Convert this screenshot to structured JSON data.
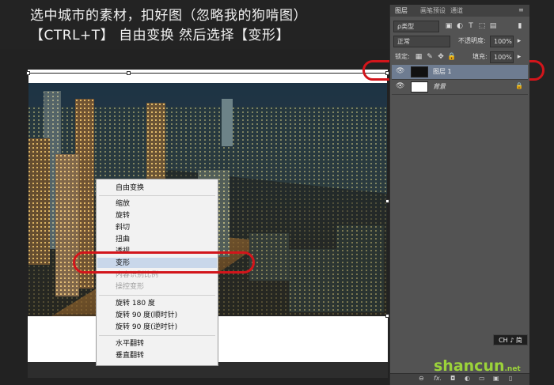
{
  "caption": {
    "line1": "选中城市的素材，扣好图（忽略我的狗啃图）",
    "line2": "【CTRL+T】 自由变换 然后选择【变形】"
  },
  "context_menu": {
    "items": [
      {
        "label": "自由变换",
        "disabled": false
      },
      {
        "label": "缩放",
        "disabled": false
      },
      {
        "label": "旋转",
        "disabled": false
      },
      {
        "label": "斜切",
        "disabled": false
      },
      {
        "label": "扭曲",
        "disabled": false
      },
      {
        "label": "透视",
        "disabled": false
      },
      {
        "label": "变形",
        "disabled": false,
        "highlighted": true
      },
      {
        "label": "内容识别比例",
        "disabled": true
      },
      {
        "label": "操控变形",
        "disabled": true
      },
      {
        "label": "旋转 180 度",
        "disabled": false
      },
      {
        "label": "旋转 90 度(顺时针)",
        "disabled": false
      },
      {
        "label": "旋转 90 度(逆时针)",
        "disabled": false
      },
      {
        "label": "水平翻转",
        "disabled": false
      },
      {
        "label": "垂直翻转",
        "disabled": false
      }
    ]
  },
  "layers_panel": {
    "tabs": [
      "图层",
      "画笔预设",
      "通道"
    ],
    "filter_kind": "ρ类型",
    "blend_mode": "正常",
    "opacity_label": "不透明度:",
    "opacity_value": "100%",
    "lock_label": "锁定:",
    "fill_label": "填充:",
    "fill_value": "100%",
    "layers": [
      {
        "name": "图层 1",
        "selected": true,
        "visible": true
      },
      {
        "name": "背景",
        "selected": false,
        "visible": true,
        "locked": true
      }
    ],
    "bottom_icons": [
      "link-icon",
      "fx-icon",
      "mask-icon",
      "adjustment-icon",
      "folder-icon",
      "new-layer-icon",
      "trash-icon"
    ]
  },
  "badge": "CH ♪ 简",
  "watermark": {
    "text": "shancun",
    "domain": ".net"
  },
  "colors": {
    "annotation_red": "#d2151b",
    "panel_bg": "#535353",
    "selected_layer": "#6e7c91",
    "menu_highlight": "#c9d7ea"
  }
}
